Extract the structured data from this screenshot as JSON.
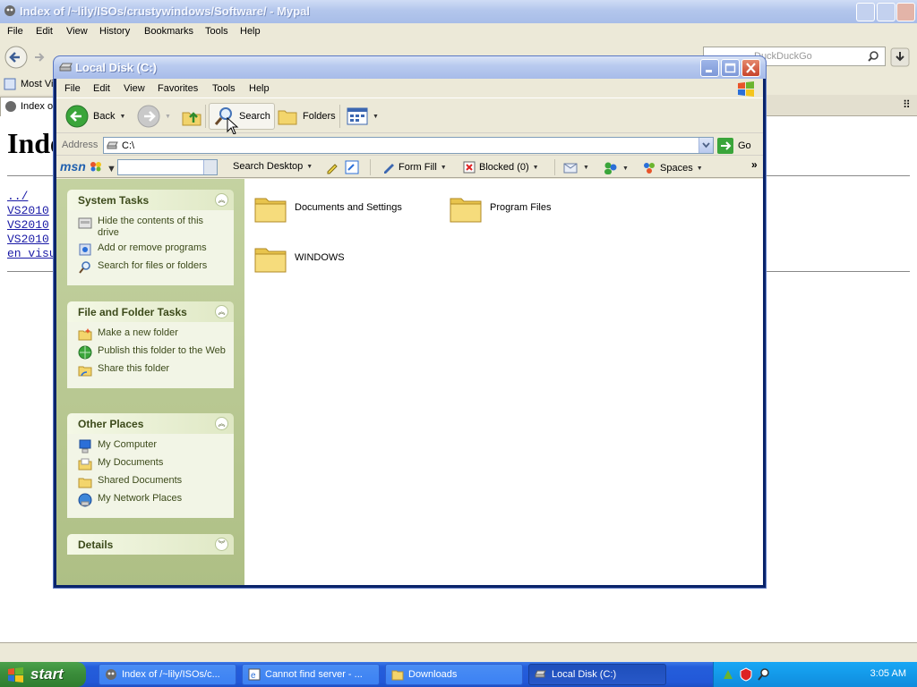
{
  "browser": {
    "title": "Index of /~lily/ISOs/crustywindows/Software/ - Mypal",
    "menu": [
      "File",
      "Edit",
      "View",
      "History",
      "Bookmarks",
      "Tools",
      "Help"
    ],
    "search_placeholder": "DuckDuckGo",
    "bookmark_label": "Most Vis",
    "tab_label": "Index o",
    "page_heading": "Index",
    "links": [
      "../",
      "VS2010",
      "VS2010",
      "VS2010",
      "en_visu"
    ]
  },
  "explorer": {
    "title": "Local Disk (C:)",
    "menu": [
      "File",
      "Edit",
      "View",
      "Favorites",
      "Tools",
      "Help"
    ],
    "toolbar": {
      "back": "Back",
      "search": "Search",
      "folders": "Folders"
    },
    "address": {
      "label": "Address",
      "value": "C:\\",
      "go": "Go"
    },
    "msn_bar": {
      "logo": "msn",
      "search_desktop": "Search Desktop",
      "form_fill": "Form Fill",
      "blocked": "Blocked (0)",
      "spaces": "Spaces"
    },
    "task_pane": {
      "system_tasks": {
        "title": "System Tasks",
        "items": [
          "Hide the contents of this drive",
          "Add or remove programs",
          "Search for files or folders"
        ]
      },
      "file_folder_tasks": {
        "title": "File and Folder Tasks",
        "items": [
          "Make a new folder",
          "Publish this folder to the Web",
          "Share this folder"
        ]
      },
      "other_places": {
        "title": "Other Places",
        "items": [
          "My Computer",
          "My Documents",
          "Shared Documents",
          "My Network Places"
        ]
      },
      "details": {
        "title": "Details"
      }
    },
    "folders": [
      "Documents and Settings",
      "Program Files",
      "WINDOWS"
    ]
  },
  "taskbar": {
    "start": "start",
    "buttons": [
      "Index of /~lily/ISOs/c...",
      "Cannot find server - ...",
      "Downloads",
      "Local Disk (C:)"
    ],
    "clock": "3:05 AM"
  },
  "colors": {
    "taskbar_blue": "#245edb",
    "start_green": "#3c8f3c",
    "task_pane_green": "#aebf85",
    "link_blue": "#1a1aa6"
  }
}
